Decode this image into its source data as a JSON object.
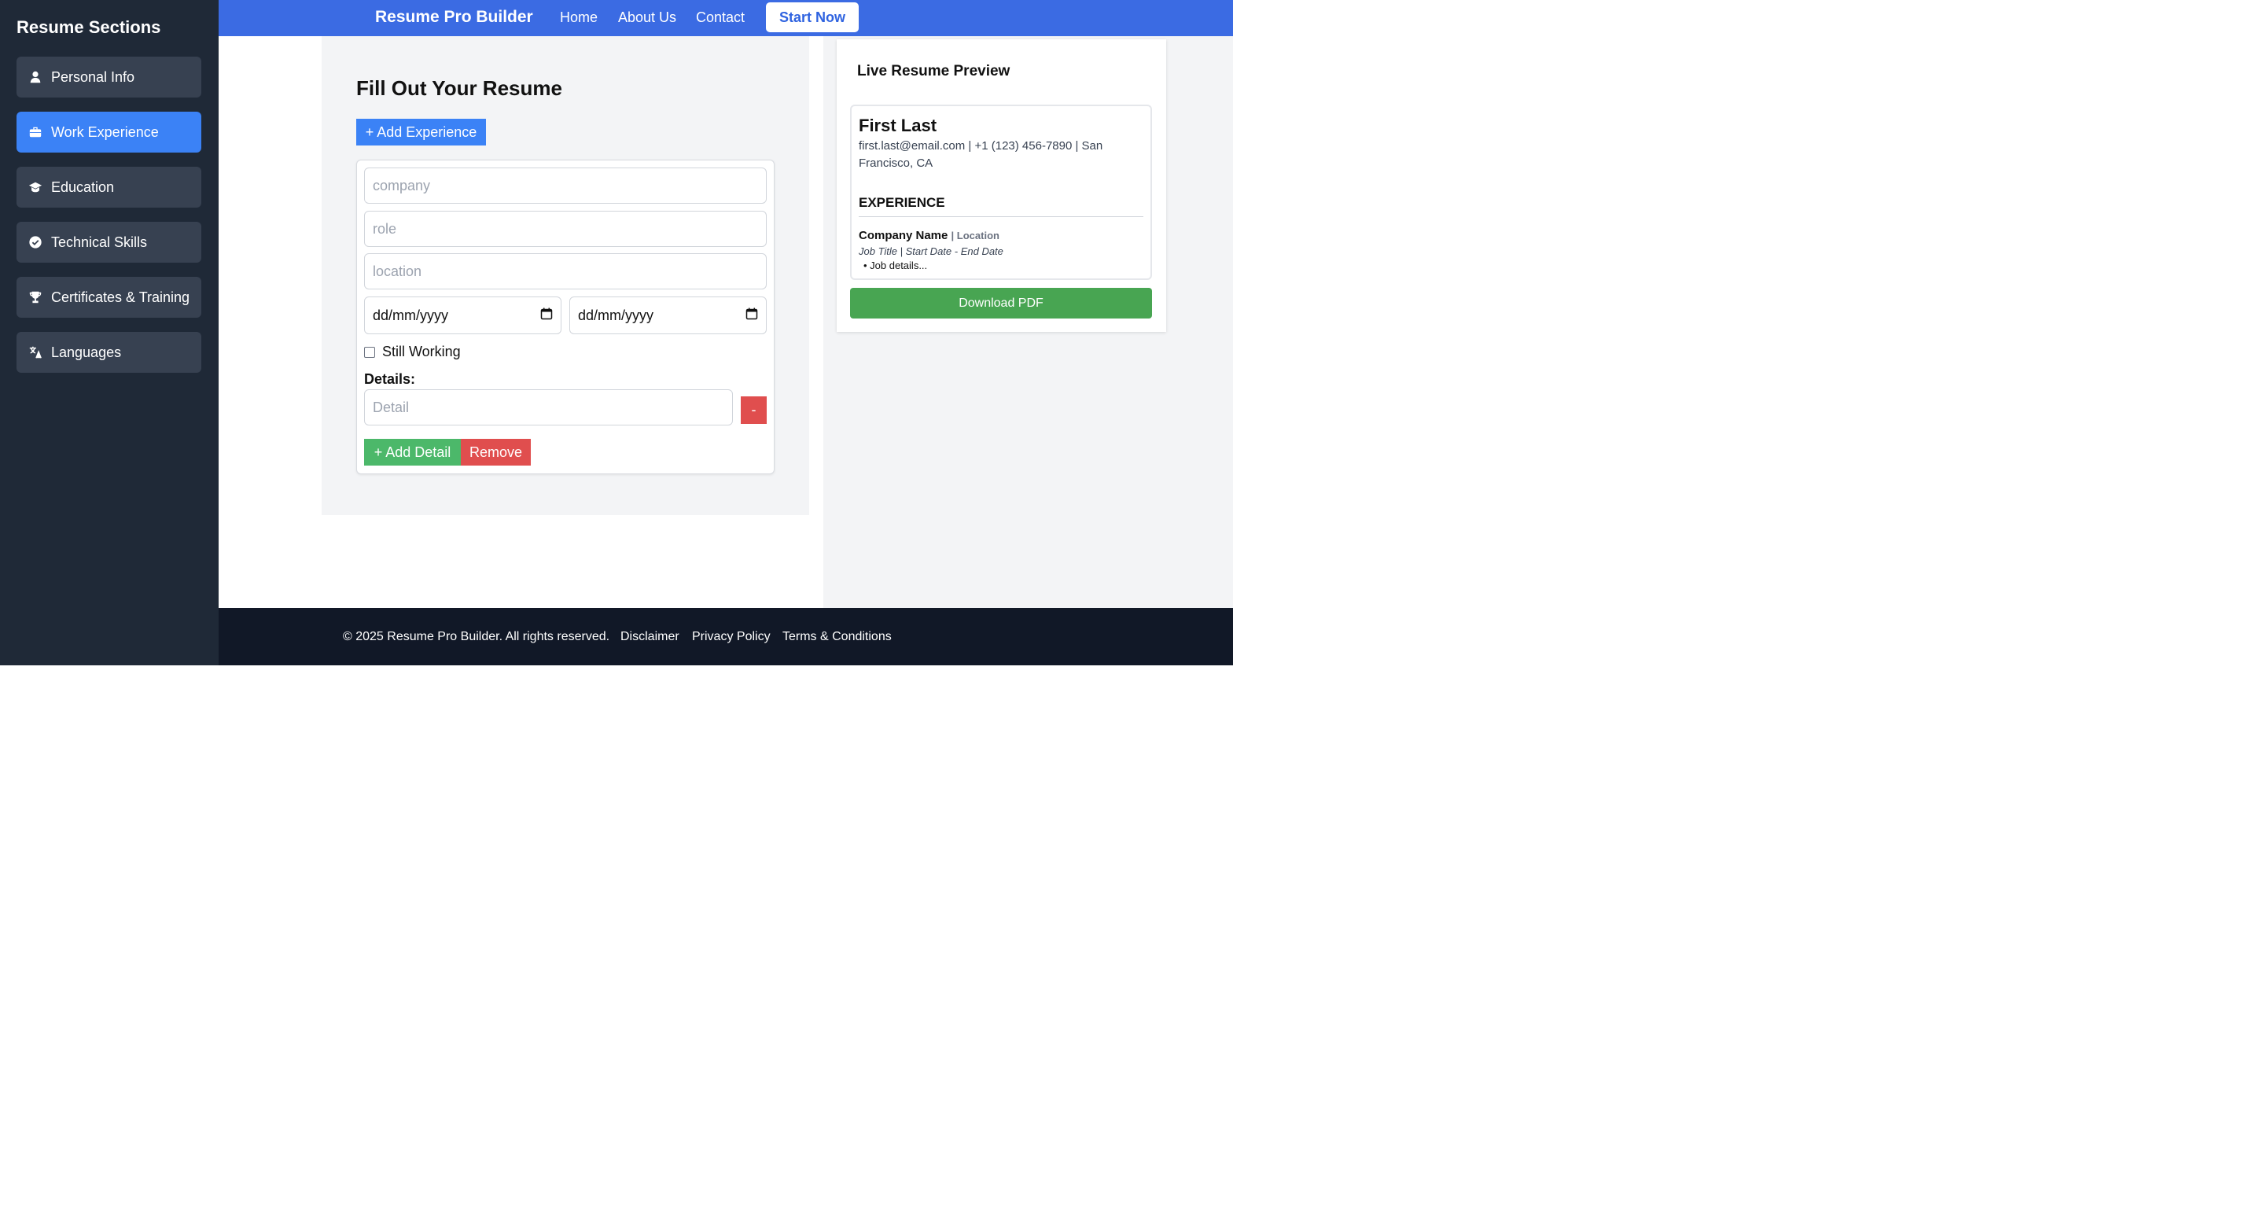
{
  "sidebar": {
    "title": "Resume Sections",
    "items": [
      {
        "label": "Personal Info",
        "icon": "user-icon"
      },
      {
        "label": "Work Experience",
        "icon": "briefcase-icon"
      },
      {
        "label": "Education",
        "icon": "graduation-cap-icon"
      },
      {
        "label": "Technical Skills",
        "icon": "check-circle-icon"
      },
      {
        "label": "Certificates & Training",
        "icon": "trophy-icon"
      },
      {
        "label": "Languages",
        "icon": "translate-icon"
      }
    ],
    "active_index": 1
  },
  "header": {
    "brand": "Resume Pro Builder",
    "nav": [
      "Home",
      "About Us",
      "Contact"
    ],
    "cta": "Start Now"
  },
  "form": {
    "title": "Fill Out Your Resume",
    "add_experience": "+ Add Experience",
    "company_placeholder": "company",
    "role_placeholder": "role",
    "location_placeholder": "location",
    "start_date": "dd/mm/yyyy",
    "end_date": "dd/mm/yyyy",
    "still_working": "Still Working",
    "details_label": "Details:",
    "detail_placeholder": "Detail",
    "remove_detail": "-",
    "add_detail": "+ Add Detail",
    "remove": "Remove"
  },
  "preview": {
    "title": "Live Resume Preview",
    "name": "First Last",
    "contact": "first.last@email.com | +1 (123) 456-7890 | San Francisco, CA",
    "section": "EXPERIENCE",
    "company": "Company Name",
    "location": "| Location",
    "job_line": "Job Title | Start Date - End Date",
    "bullet": "• Job details...",
    "download": "Download PDF"
  },
  "footer": {
    "copyright": "© 2025 Resume Pro Builder. All rights reserved.",
    "links": [
      "Disclaimer",
      "Privacy Policy",
      "Terms & Conditions"
    ]
  },
  "colors": {
    "sidebar_bg": "#1f2937",
    "header_bg": "#3b6be3",
    "active_item": "#3b82f6",
    "success": "#4cb86a",
    "danger": "#e04e4e",
    "download": "#48a552",
    "footer_bg": "#111827"
  }
}
